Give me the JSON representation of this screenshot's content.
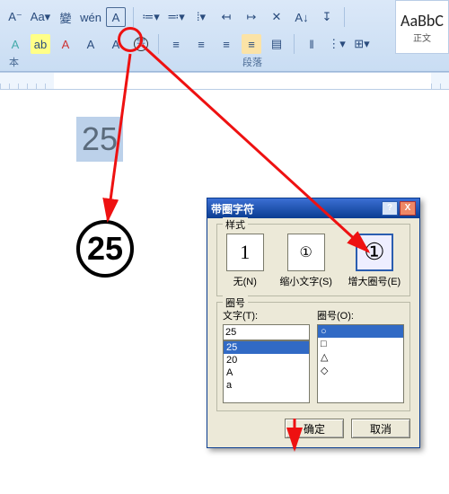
{
  "ribbon": {
    "row1": [
      "A⁻",
      "Aa▾",
      "變",
      "wén",
      "A",
      "≔▾",
      "≕▾",
      "⁞▾",
      "↤",
      "↦",
      "✕",
      "A↓",
      "↧"
    ],
    "row2": [
      "A",
      "ab",
      "A",
      "A",
      "A",
      "字",
      "≡",
      "≡",
      "≡",
      "≡",
      "▤",
      "‖",
      "⋮▾",
      "⊞▾"
    ],
    "font_group": "本",
    "para_group": "段落",
    "style_sample": "AaBbC",
    "style_name": "正文",
    "enclose_tooltip": "带圈字符"
  },
  "document": {
    "selected_text": "25",
    "result_text": "25"
  },
  "dialog": {
    "title": "带圈字符",
    "help_btn": "?",
    "close_btn": "X",
    "style_legend": "样式",
    "styles": [
      {
        "glyph": "1",
        "label": "无(N)"
      },
      {
        "glyph": "①",
        "label": "缩小文字(S)"
      },
      {
        "glyph": "①",
        "label": "增大圈号(E)",
        "selected": true
      }
    ],
    "enc_legend": "圈号",
    "text_label": "文字(T):",
    "shape_label": "圈号(O):",
    "text_value": "25",
    "text_list": [
      "25",
      "20",
      "A",
      "a"
    ],
    "text_selected": "25",
    "shape_list": [
      "○",
      "□",
      "△",
      "◇"
    ],
    "shape_selected": "○",
    "ok": "确定",
    "cancel": "取消"
  }
}
